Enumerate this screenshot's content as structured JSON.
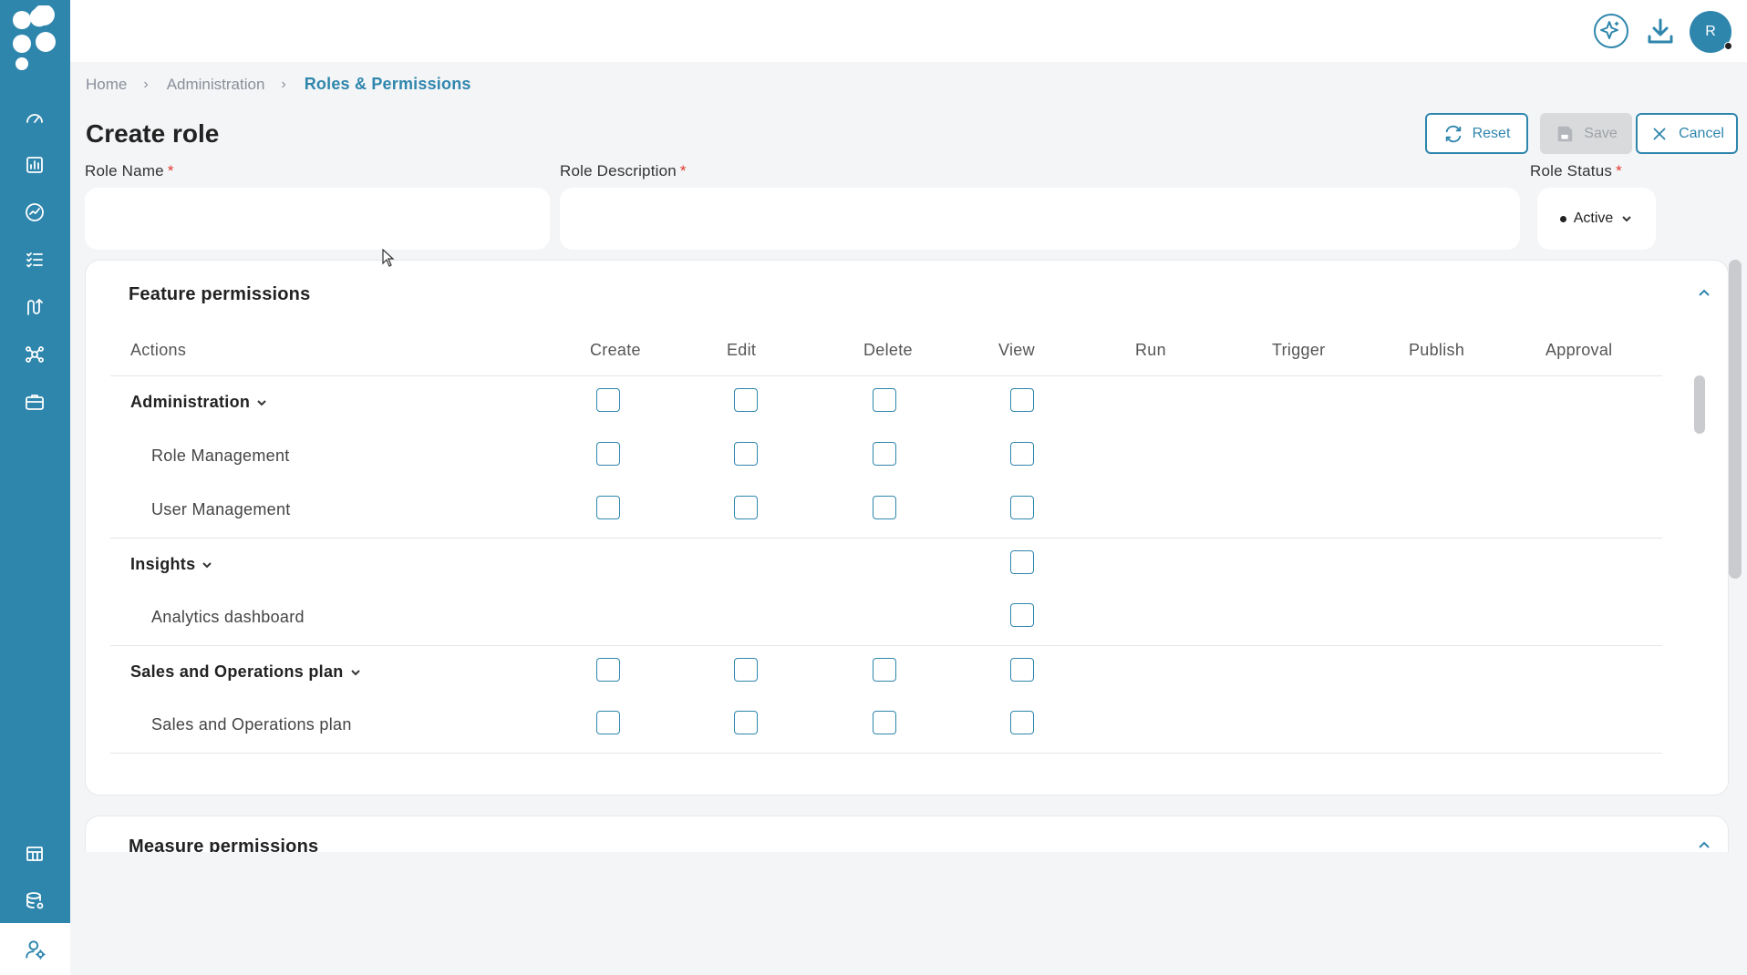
{
  "topbar": {
    "ai_icon": "sparkle-icon",
    "download_icon": "download-icon",
    "avatar_initial": "R"
  },
  "breadcrumb": {
    "items": [
      "Home",
      "Administration"
    ],
    "current": "Roles & Permissions"
  },
  "page": {
    "title": "Create role"
  },
  "actions": {
    "reset": "Reset",
    "save": "Save",
    "cancel": "Cancel"
  },
  "form": {
    "role_name": {
      "label": "Role Name",
      "required": "*",
      "value": ""
    },
    "role_description": {
      "label": "Role Description",
      "required": "*",
      "value": ""
    },
    "role_status": {
      "label": "Role Status",
      "required": "*",
      "value": "Active"
    }
  },
  "feature_permissions": {
    "title": "Feature permissions",
    "columns": [
      "Actions",
      "Create",
      "Edit",
      "Delete",
      "View",
      "Run",
      "Trigger",
      "Publish",
      "Approval"
    ],
    "rows": [
      {
        "label": "Administration",
        "type": "group",
        "checks": [
          "Create",
          "Edit",
          "Delete",
          "View"
        ]
      },
      {
        "label": "Role Management",
        "type": "sub",
        "checks": [
          "Create",
          "Edit",
          "Delete",
          "View"
        ]
      },
      {
        "label": "User Management",
        "type": "sub",
        "checks": [
          "Create",
          "Edit",
          "Delete",
          "View"
        ]
      },
      {
        "label": "Insights",
        "type": "group",
        "checks": [
          "View"
        ]
      },
      {
        "label": "Analytics dashboard",
        "type": "sub",
        "checks": [
          "View"
        ]
      },
      {
        "label": "Sales and Operations plan",
        "type": "group",
        "checks": [
          "Create",
          "Edit",
          "Delete",
          "View"
        ]
      },
      {
        "label": "Sales and Operations plan",
        "type": "sub",
        "checks": [
          "Create",
          "Edit",
          "Delete",
          "View"
        ]
      }
    ]
  },
  "measure_permissions": {
    "title": "Measure permissions"
  },
  "colors": {
    "brand": "#2f86ad",
    "background": "#f4f5f7",
    "required": "#e0392f",
    "disabled": "#d9dadc"
  }
}
